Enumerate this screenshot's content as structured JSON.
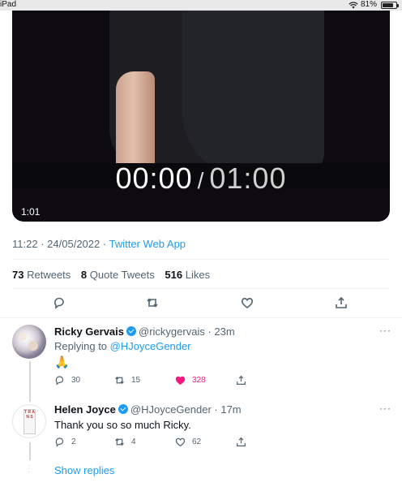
{
  "status_bar": {
    "carrier": "iPad",
    "wifi_icon": "wifi-icon",
    "battery": "81%",
    "battery_level": 0.81
  },
  "video": {
    "current_time": "00:00",
    "separator": "/",
    "total_time": "01:00",
    "duration_badge": "1:01"
  },
  "tweet_meta": {
    "time": "11:22",
    "dot": "·",
    "date": "24/05/2022",
    "source": "Twitter Web App"
  },
  "stats": {
    "retweets_count": "73",
    "retweets_label": "Retweets",
    "quotes_count": "8",
    "quotes_label": "Quote Tweets",
    "likes_count": "516",
    "likes_label": "Likes"
  },
  "action_icons": [
    "reply-icon",
    "retweet-icon",
    "like-icon",
    "share-icon"
  ],
  "replies": [
    {
      "name": "Ricky Gervais",
      "handle": "@rickygervais",
      "time": "· 23m",
      "replying_prefix": "Replying to",
      "replying_to": "@HJoyceGender",
      "text": "🙏",
      "replies": "30",
      "retweets": "15",
      "likes": "328",
      "liked": true
    },
    {
      "name": "Helen Joyce",
      "handle": "@HJoyceGender",
      "time": "· 17m",
      "text": "Thank you so so much Ricky.",
      "replies": "2",
      "retweets": "4",
      "likes": "62",
      "liked": false,
      "avatar_text": "T R A N S"
    }
  ],
  "more_label": "···",
  "show_replies": "Show replies",
  "colors": {
    "accent": "#1d9bf0",
    "like": "#f91880",
    "muted": "#536471"
  }
}
